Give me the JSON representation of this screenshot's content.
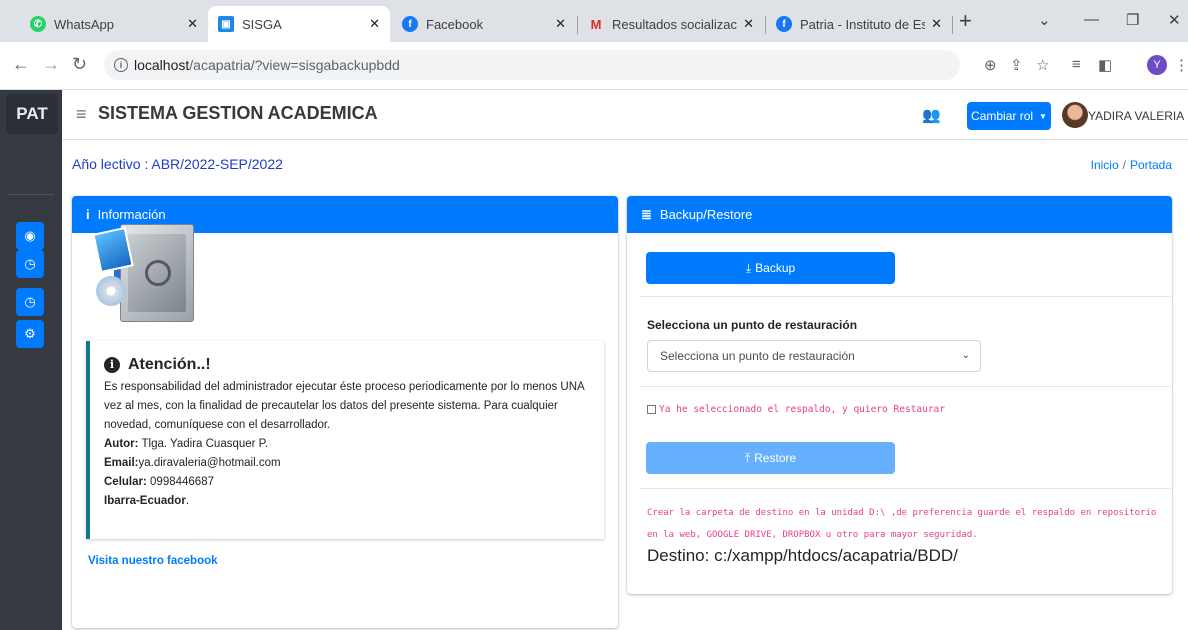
{
  "browser": {
    "tabs": [
      {
        "title": "WhatsApp",
        "icon": "whatsapp-icon",
        "color": "#25d366",
        "glyph": "✆"
      },
      {
        "title": "SISGA",
        "icon": "sisga-icon",
        "color": "#1e88e5",
        "glyph": "▣"
      },
      {
        "title": "Facebook",
        "icon": "facebook-icon",
        "color": "#1877f2",
        "glyph": "f"
      },
      {
        "title": "Resultados socialización y",
        "icon": "gmail-icon",
        "color": "#d93025",
        "glyph": "M"
      },
      {
        "title": "Patria - Instituto de Estéti",
        "icon": "facebook-icon",
        "color": "#1877f2",
        "glyph": "f"
      }
    ],
    "url_host": "localhost",
    "url_path": "/acapatria/?view=sisgabackupbdd",
    "profile_initial": "Y"
  },
  "sidebar": {
    "logo": "PAT",
    "buttons": [
      {
        "icon": "dashboard-icon",
        "glyph": "◉"
      },
      {
        "icon": "clock-icon",
        "glyph": "◷"
      },
      {
        "icon": "clock-icon",
        "glyph": "◷"
      },
      {
        "icon": "cogs-icon",
        "glyph": "⚙"
      }
    ]
  },
  "navbar": {
    "title": "SISTEMA GESTION ACADEMICA",
    "role_button": "Cambiar rol",
    "user_name": "YADIRA VALERIA"
  },
  "header": {
    "school_year": "Año lectivo : ABR/2022-SEP/2022",
    "breadcrumb_home": "Inicio",
    "breadcrumb_current": "Portada"
  },
  "info_card": {
    "title": "Información",
    "attention_title": "Atención..!",
    "message": "Es responsabilidad del administrador ejecutar éste proceso periodicamente por lo menos UNA vez al mes, con la finalidad de precautelar los datos del presente sistema. Para cualquier novedad, comuníquese con el desarrollador.",
    "author_label": "Autor:",
    "author_value": " Tlga. Yadira Cuasquer P.",
    "email_label": "Email:",
    "email_value": "ya.diravaleria@hotmail.com",
    "phone_label": "Celular:",
    "phone_value": " 0998446687",
    "location_bold": "Ibarra-Ecuador",
    "location_suffix": ".",
    "facebook_link": "Visita nuestro facebook"
  },
  "backup_card": {
    "title": "Backup/Restore",
    "backup_button": "Backup",
    "restore_label": "Selecciona un punto de restauración",
    "select_value": "Selecciona un punto de restauración",
    "confirm_checkbox": "Ya he seleccionado el respaldo, y quiero Restaurar",
    "restore_button": "Restore",
    "note": "Crear la carpeta de destino en la unidad D:\\ ,de preferencia guarde el respaldo en repositorio en la web, GOOGLE DRIVE, DROPBOX u otro para mayor seguridad.",
    "destination": "Destino: c:/xampp/htdocs/acapatria/BDD/"
  }
}
